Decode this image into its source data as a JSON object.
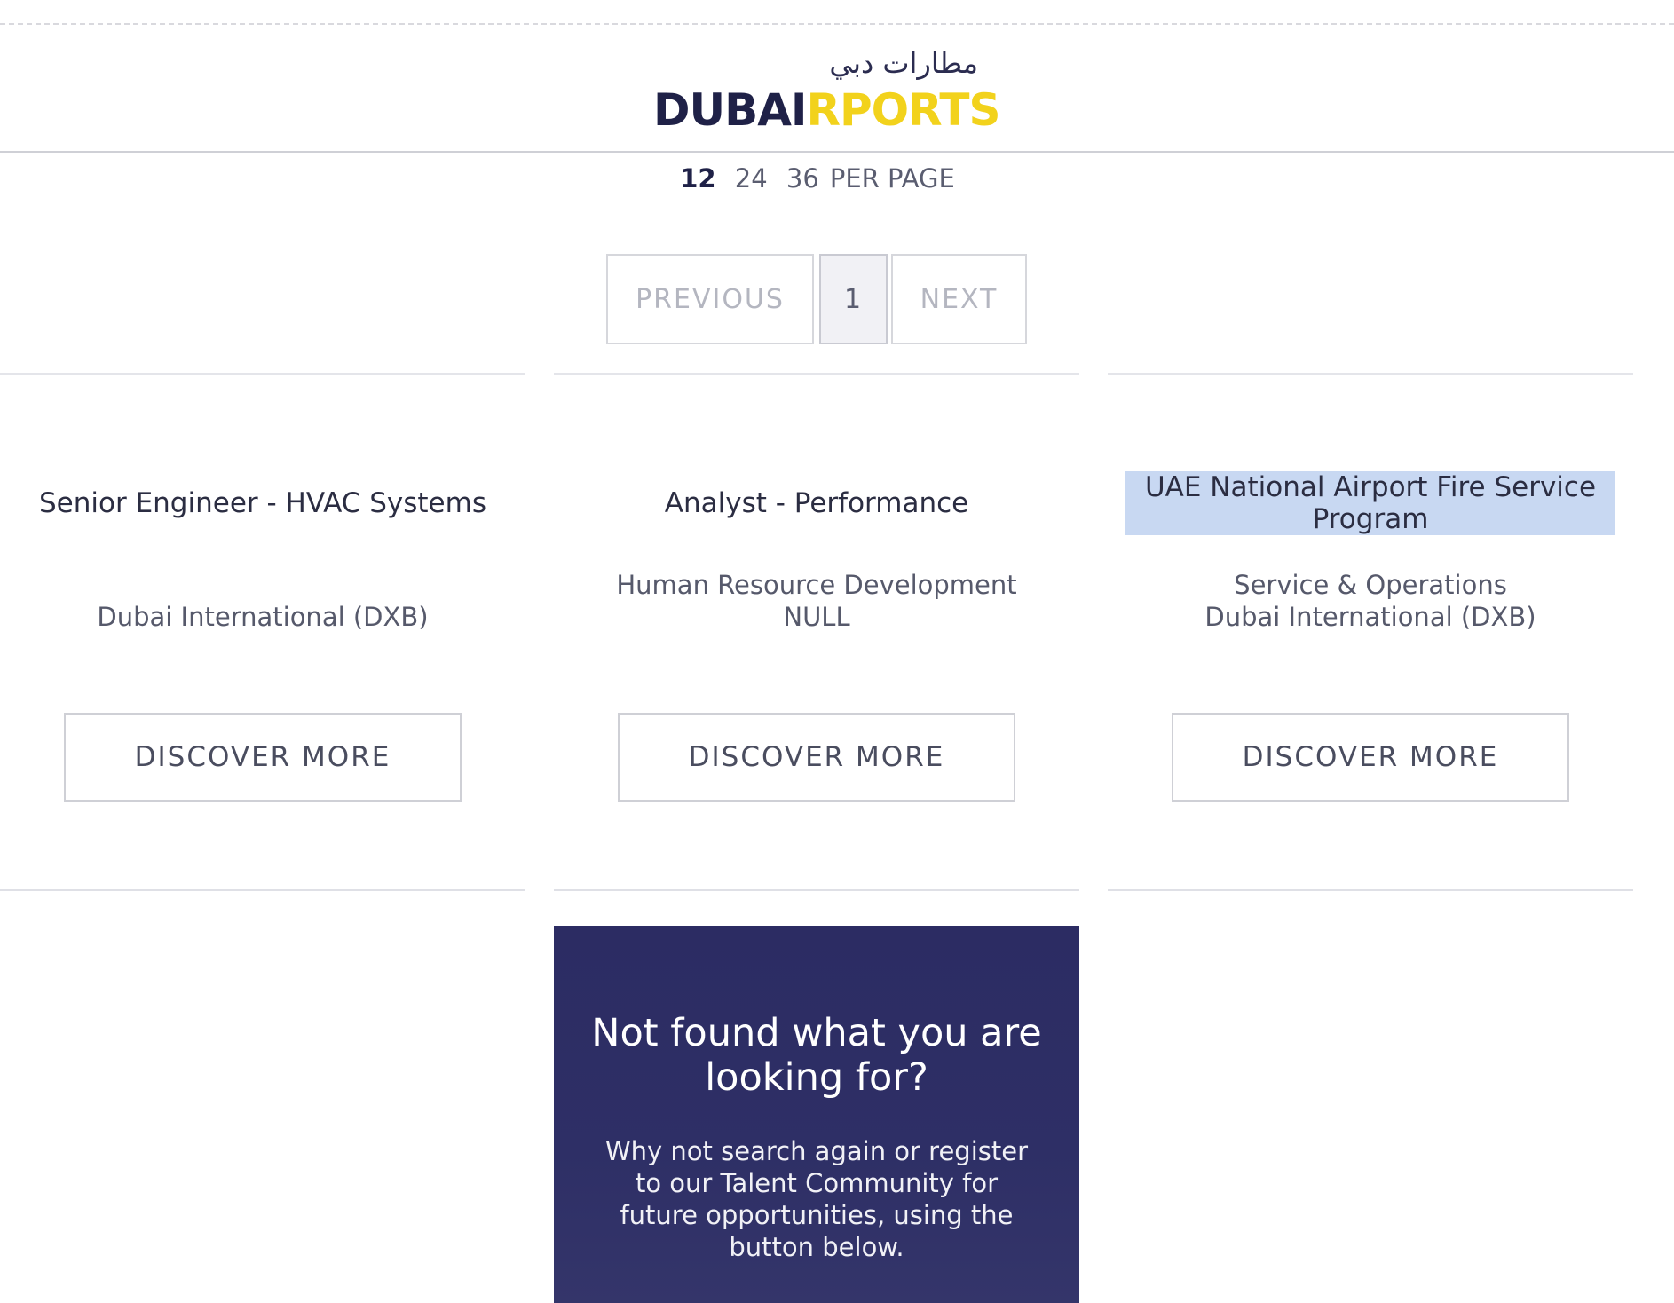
{
  "header": {
    "logo_arabic": "مطارات دبي",
    "logo_latin_part1": "DUBAI",
    "logo_latin_part2": "RPORTS"
  },
  "per_page": {
    "options": [
      "12",
      "24",
      "36"
    ],
    "selected": "12",
    "suffix": "PER PAGE"
  },
  "pagination": {
    "previous_label": "PREVIOUS",
    "current_page": "1",
    "next_label": "NEXT"
  },
  "jobs": [
    {
      "title": "Senior Engineer - HVAC Systems",
      "meta_line1": "",
      "meta_line2": "Dubai International (DXB)",
      "button_label": "DISCOVER MORE"
    },
    {
      "title": "Analyst - Performance",
      "meta_line1": "Human Resource Development",
      "meta_line2": "NULL",
      "button_label": "DISCOVER MORE"
    },
    {
      "title": "UAE National Airport Fire Service Program",
      "meta_line1": "Service & Operations",
      "meta_line2": "Dubai International (DXB)",
      "button_label": "DISCOVER MORE"
    }
  ],
  "cta": {
    "title": "Not found what you are looking for?",
    "text": "Why not search again or register to our Talent Community for future opportunities, using the button below."
  },
  "colors": {
    "brand_navy": "#1f2147",
    "brand_gold": "#f2d21c",
    "cta_background": "#2c2c63",
    "selection_highlight": "#c8d8f2"
  }
}
